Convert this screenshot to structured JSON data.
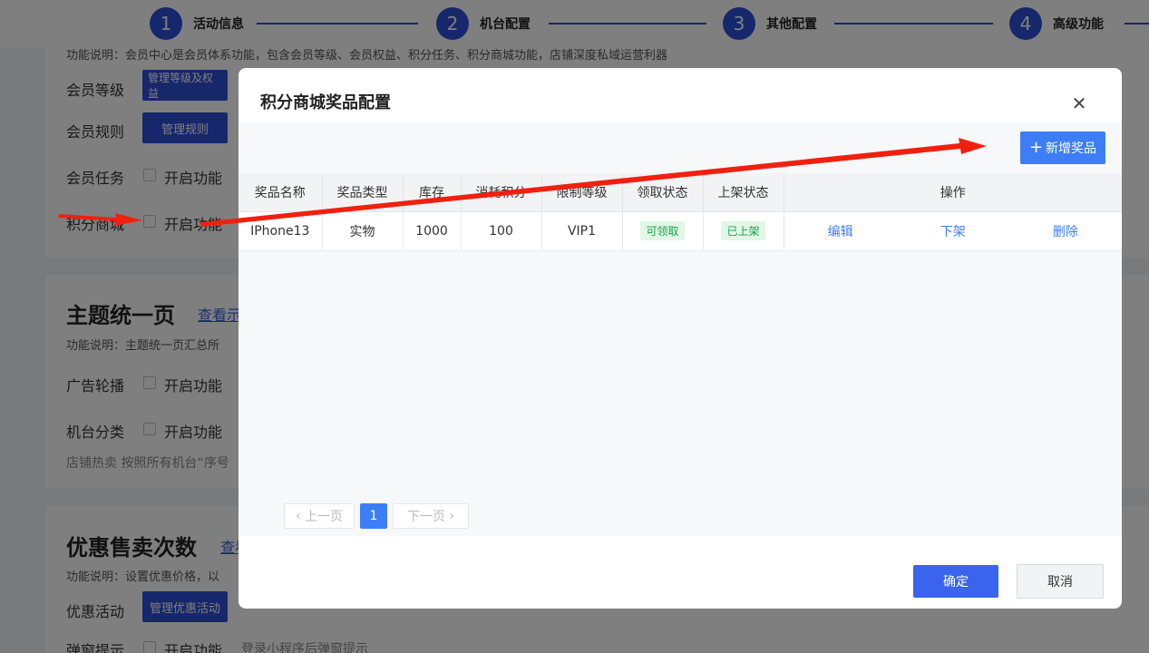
{
  "steps": [
    {
      "num": "1",
      "label": "活动信息"
    },
    {
      "num": "2",
      "label": "机台配置"
    },
    {
      "num": "3",
      "label": "其他配置"
    },
    {
      "num": "4",
      "label": "高级功能"
    }
  ],
  "member_section": {
    "desc": "功能说明：会员中心是会员体系功能，包含会员等级、会员权益、积分任务、积分商城功能，店铺深度私域运营利器",
    "level_label": "会员等级",
    "level_button": "管理等级及权益",
    "rule_label": "会员规则",
    "rule_button": "管理规则",
    "task_label": "会员任务",
    "task_enable": "开启功能",
    "mall_label": "积分商城",
    "mall_enable": "开启功能"
  },
  "theme_section": {
    "title": "主题统一页",
    "link": "查看示",
    "desc": "功能说明：主题统一页汇总所",
    "banner_label": "广告轮播",
    "banner_enable": "开启功能",
    "category_label": "机台分类",
    "category_enable": "开启功能",
    "hot_hint": "店铺热卖 按照所有机台“序号"
  },
  "discount_section": {
    "title": "优惠售卖次数",
    "link": "查看",
    "desc": "功能说明：设置优惠价格，以",
    "activity_label": "优惠活动",
    "activity_button": "管理优惠活动",
    "popup_label": "弹窗提示",
    "popup_enable": "开启功能",
    "popup_hint": "登录小程序后弹窗提示"
  },
  "modal": {
    "title": "积分商城奖品配置",
    "close_icon": "close-icon",
    "add_button": "新增奖品",
    "columns": [
      "奖品名称",
      "奖品类型",
      "库存",
      "消耗积分",
      "限制等级",
      "领取状态",
      "上架状态",
      "操作"
    ],
    "rows": [
      {
        "name": "IPhone13",
        "type": "实物",
        "stock": "1000",
        "points": "100",
        "level": "VIP1",
        "claim_status": "可领取",
        "shelf_status": "已上架",
        "actions": [
          "编辑",
          "下架",
          "删除"
        ]
      }
    ],
    "pagination": {
      "prev": "上一页",
      "current": "1",
      "next": "下一页"
    },
    "confirm_button": "确定",
    "cancel_button": "取消"
  },
  "colors": {
    "primary": "#2d4ed8",
    "accent_blue": "#3d7ef6",
    "success_green": "#19a34a",
    "annotation_red": "#f02010"
  }
}
